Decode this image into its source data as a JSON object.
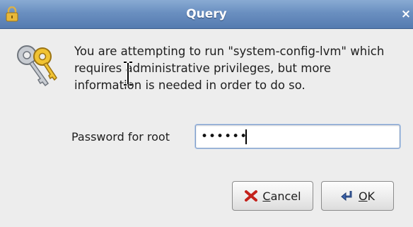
{
  "window": {
    "title": "Query",
    "close_glyph": "×"
  },
  "dialog": {
    "icon": "keys-icon",
    "message_line1": "You are attempting to run \"system-config-lvm\" which",
    "message_line2": "requires administrative privileges, but more",
    "message_line3": "information is needed in order to do so."
  },
  "password": {
    "label": "Password for root",
    "masked_value": "••••••"
  },
  "buttons": {
    "cancel_mnemonic": "C",
    "cancel_rest": "ancel",
    "ok_mnemonic": "O",
    "ok_rest": "K"
  },
  "colors": {
    "titlebar": "#6a8fc0",
    "background": "#ededed",
    "cancel_icon": "#c4221c"
  }
}
